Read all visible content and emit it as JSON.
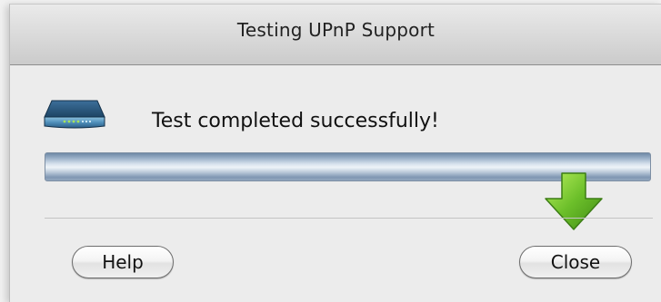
{
  "window": {
    "title": "Testing UPnP Support"
  },
  "status": {
    "icon": "router-icon",
    "message": "Test completed successfully!",
    "progress": 1.0
  },
  "hint": {
    "icon": "down-arrow-icon",
    "color": "#6cbf2a"
  },
  "buttons": {
    "help_label": "Help",
    "close_label": "Close"
  }
}
